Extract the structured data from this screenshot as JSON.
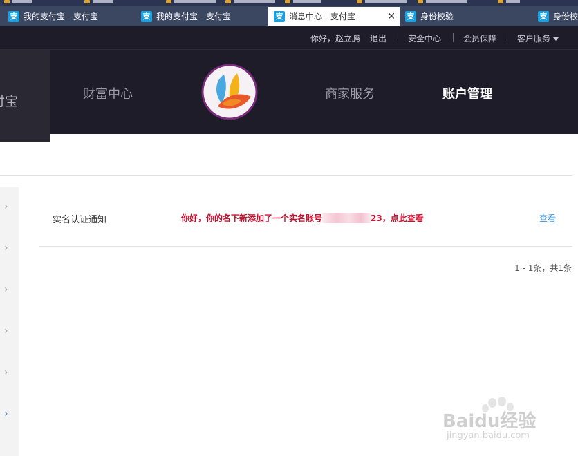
{
  "tabs": [
    {
      "title": "我的支付宝 - 支付宝",
      "icon": "alipay-icon",
      "active": false
    },
    {
      "title": "我的支付宝 - 支付宝",
      "icon": "alipay-icon",
      "active": false
    },
    {
      "title": "消息中心 - 支付宝",
      "icon": "alipay-icon",
      "active": true
    },
    {
      "title": "身份校验",
      "icon": "alipay-icon",
      "active": false
    },
    {
      "title": "身份校",
      "icon": "alipay-icon",
      "active": false
    }
  ],
  "tab_icon_glyph": "支",
  "tab_close_glyph": "✕",
  "topbar": {
    "greeting": "你好，赵立腾",
    "logout": "退出",
    "security_center": "安全中心",
    "member_protection": "会员保障",
    "customer_service": "客户服务"
  },
  "nav": {
    "brand": "付宝",
    "wealth": "财富中心",
    "merchant": "商家服务",
    "account": "账户管理"
  },
  "message": {
    "title": "实名认证通知",
    "body_prefix": "你好，你的名下新添加了一个实名账号",
    "body_suffix": "23，点此查看",
    "action": "查看"
  },
  "pagination": "1 - 1条，共1条",
  "left_rail_chevron": "›",
  "watermark": {
    "text": "Baidu经验",
    "sub": "jingyan.baidu.com"
  },
  "colors": {
    "header_bg": "#1f1c2a",
    "message_red": "#c8102e",
    "link_blue": "#3a8fd4"
  }
}
